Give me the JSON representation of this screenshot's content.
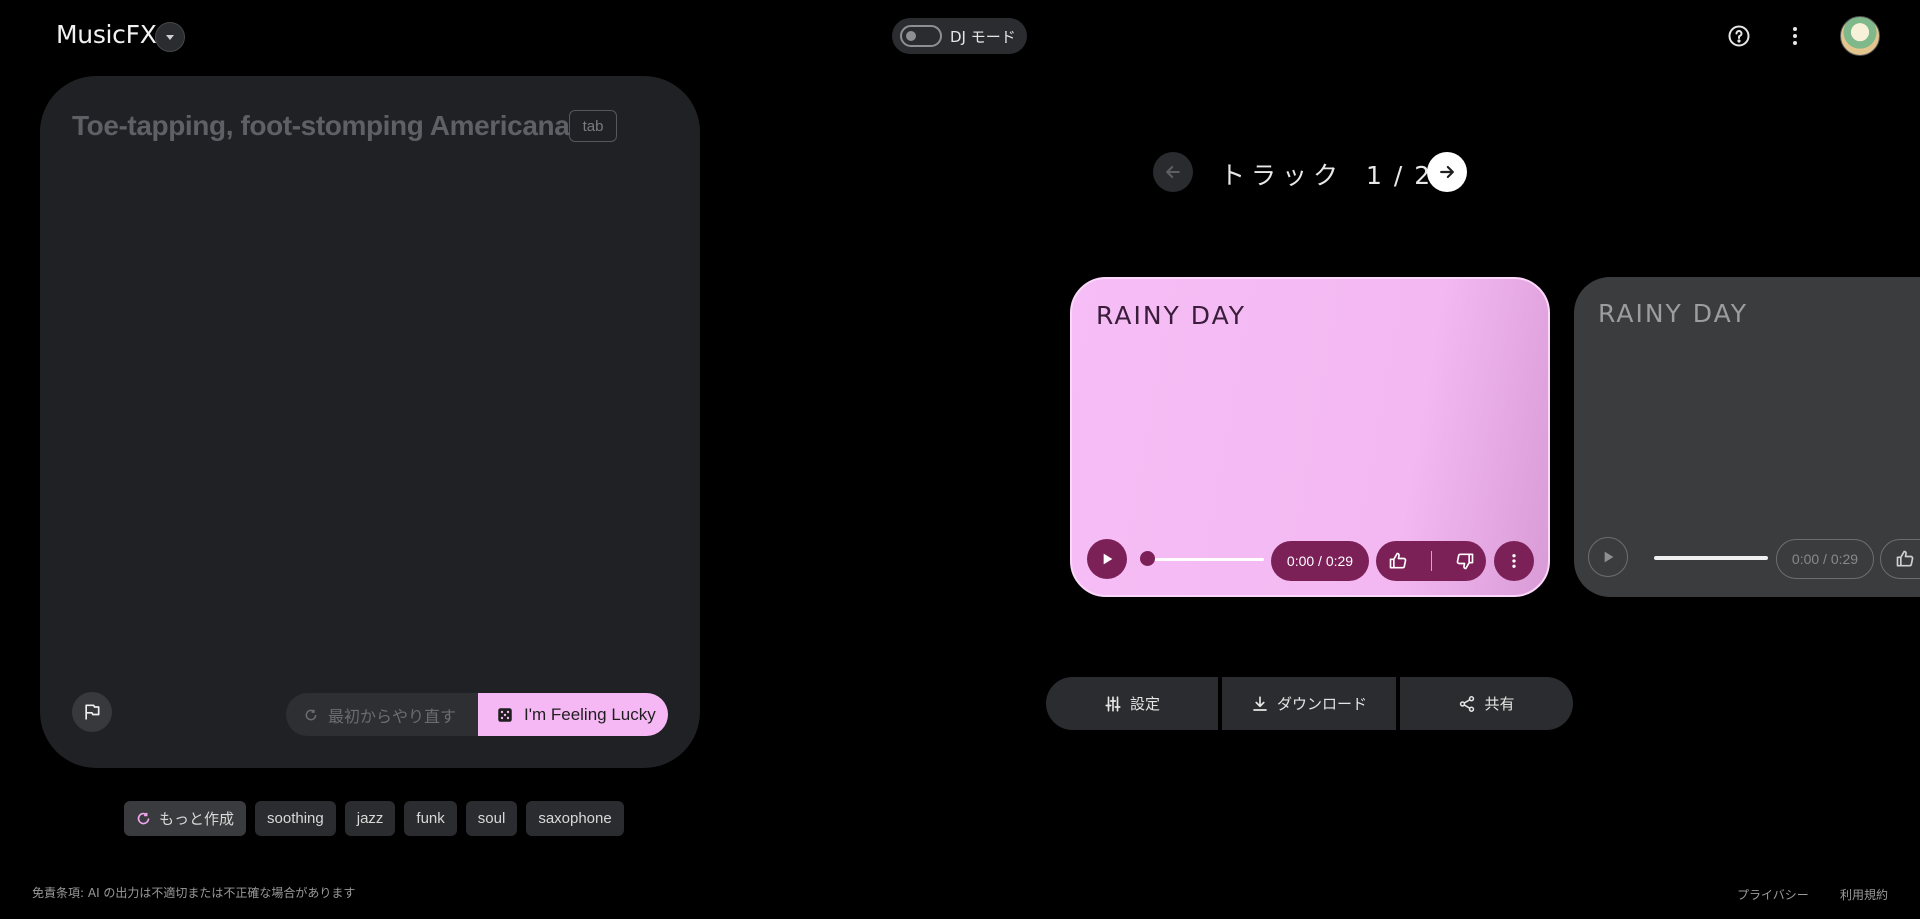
{
  "header": {
    "app_title": "MusicFX",
    "dj_mode_label": "DJ モード"
  },
  "prompt": {
    "placeholder_text": "Toe-tapping, foot-stomping Americana",
    "tab_hint": "tab",
    "restart_label": "最初からやり直す",
    "lucky_label": "I'm Feeling Lucky"
  },
  "chips": {
    "more_label": "もっと作成",
    "items": [
      "soothing",
      "jazz",
      "funk",
      "soul",
      "saxophone"
    ]
  },
  "tracks": {
    "title": "トラック",
    "counter": "1 / 2",
    "cards": [
      {
        "name": "RAINY DAY",
        "time": "0:00 / 0:29"
      },
      {
        "name": "RAINY DAY",
        "time": "0:00 / 0:29"
      }
    ]
  },
  "actions": {
    "settings_label": "設定",
    "download_label": "ダウンロード",
    "share_label": "共有"
  },
  "footer": {
    "disclaimer": "免責条項: AI の出力は不適切または不正確な場合があります",
    "privacy_label": "プライバシー",
    "terms_label": "利用規約"
  },
  "colors": {
    "accent_pink": "#f6b8f4",
    "accent_plum": "#7c2058",
    "card_bg": "#202124"
  }
}
